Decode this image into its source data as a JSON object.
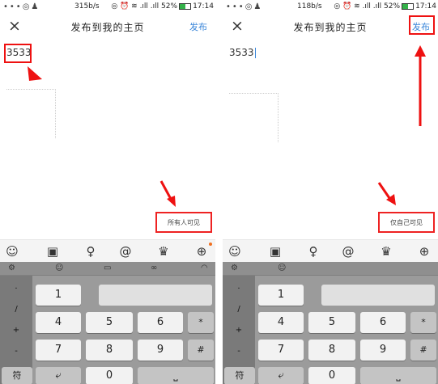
{
  "left": {
    "status": {
      "left_icons": "•••◎♟",
      "speed": "315b/s",
      "icons": "◎ ⏰ ≋ .ıll .ıll",
      "battery": "52%",
      "time": "17:14"
    },
    "close_icon": "×",
    "title": "发布到我的主页",
    "publish_label": "发布",
    "editor_text": "3533",
    "visibility_label": "所有人可见"
  },
  "right": {
    "status": {
      "left_icons": "•••◎♟",
      "speed": "118b/s",
      "icons": "◎ ⏰ ≋ .ıll .ıll",
      "battery": "52%",
      "time": "17:14"
    },
    "close_icon": "×",
    "title": "发布到我的主页",
    "publish_label": "发布",
    "editor_text": "3533",
    "visibility_label": "仅自己可见"
  },
  "toolbar": {
    "icons": [
      "emoji-icon",
      "image-icon",
      "mic-icon",
      "at-icon",
      "crown-icon",
      "plus-icon"
    ],
    "glyphs": [
      "☺",
      "▣",
      "♀",
      "@",
      "♛",
      "⊕"
    ]
  },
  "keyboard": {
    "top_icons": [
      "⚙",
      "☺",
      "▭",
      "∞",
      "◠"
    ],
    "side_keys": [
      ".",
      "/",
      "+",
      "-"
    ],
    "digits": [
      "1",
      "4",
      "5",
      "6",
      "7",
      "8",
      "9",
      "0"
    ],
    "symbol_keys": [
      "*",
      "#"
    ],
    "bottom_left": "符",
    "enter_glyph": "⤶",
    "space_glyph": "⎵"
  },
  "colors": {
    "accent": "#3a86d9",
    "highlight": "#e11111",
    "battery": "#34b24a"
  }
}
